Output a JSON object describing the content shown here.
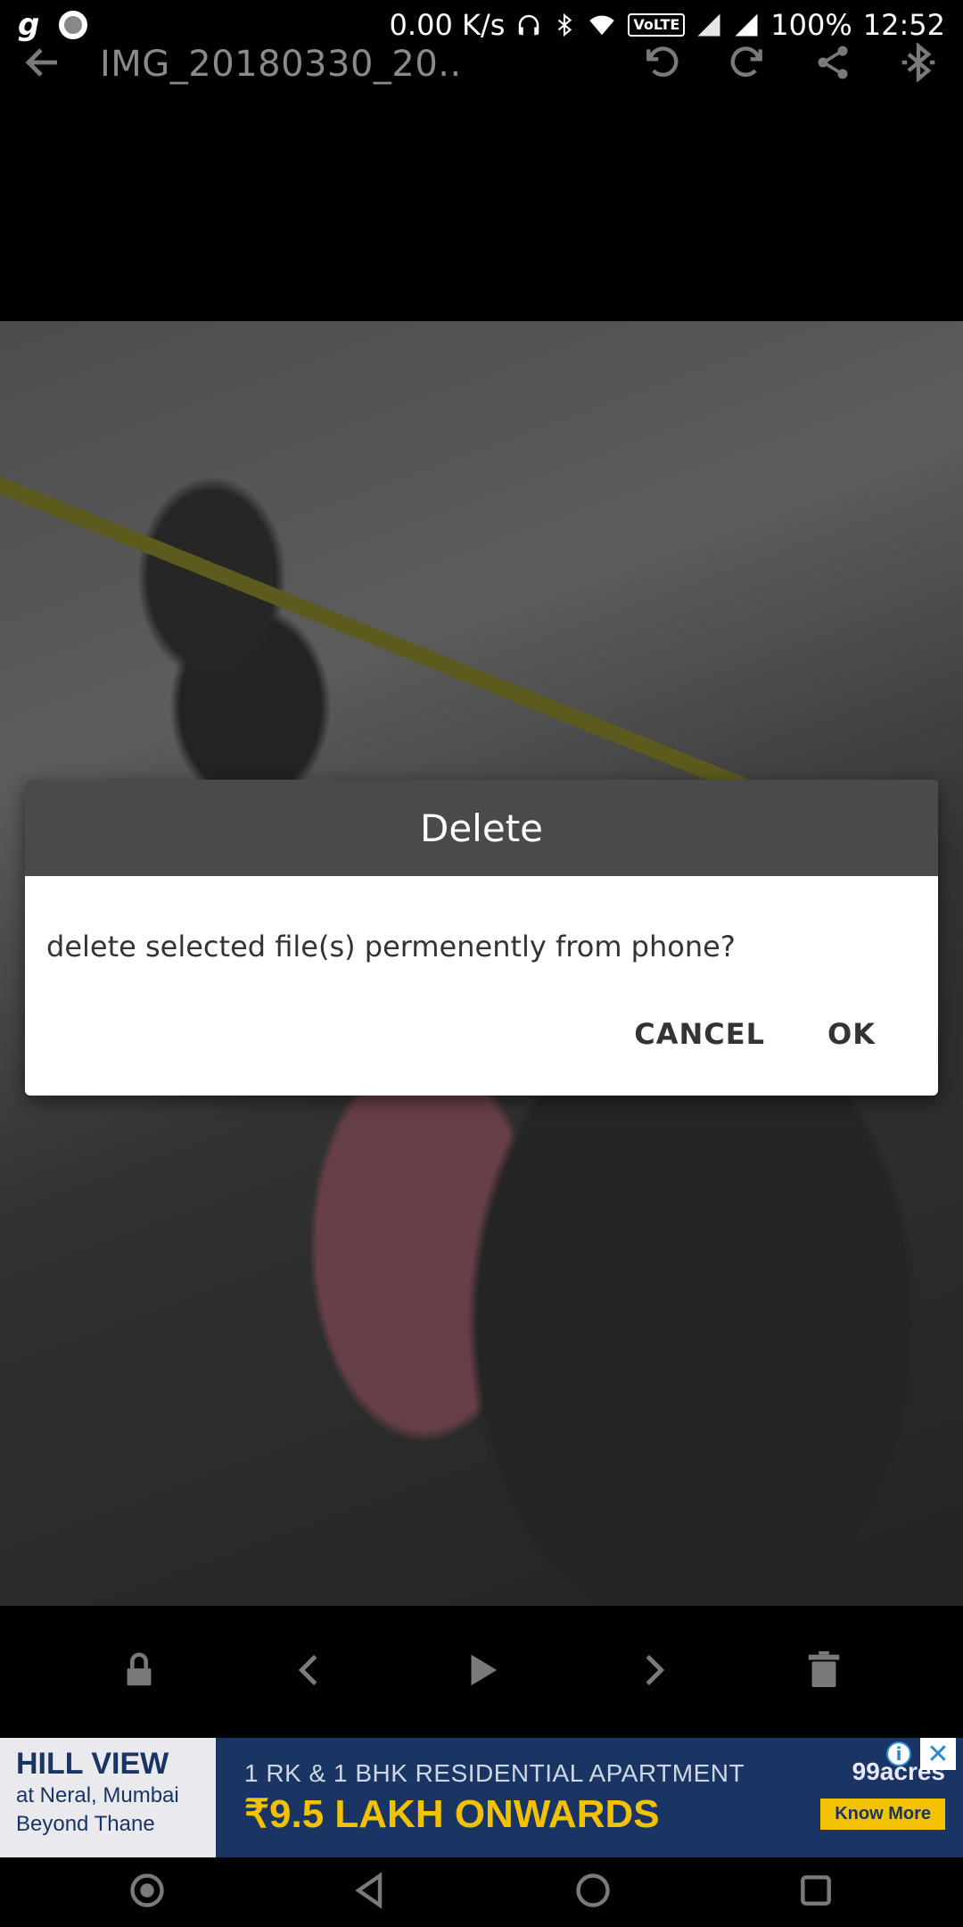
{
  "status_bar": {
    "app_icon_g": "g",
    "net_speed": "0.00 K/s",
    "volte": "VoLTE",
    "battery": "100%",
    "time": "12:52"
  },
  "toolbar": {
    "title": "IMG_20180330_20.."
  },
  "dialog": {
    "title": "Delete",
    "message": "delete selected file(s) permenently from phone?",
    "cancel_label": "CANCEL",
    "ok_label": "OK"
  },
  "ad": {
    "left_title": "HILL VIEW",
    "left_line1": "at Neral, Mumbai",
    "left_line2": "Beyond Thane",
    "headline": "1 RK & 1 BHK RESIDENTIAL APARTMENT",
    "price": "₹9.5 LAKH ONWARDS",
    "brand": "99acres",
    "cta": "Know More",
    "info_symbol": "i",
    "close_symbol": "✕"
  },
  "colors": {
    "dialog_header": "#4a4a4a",
    "ad_background": "#1a3564",
    "ad_accent": "#f2c200"
  }
}
